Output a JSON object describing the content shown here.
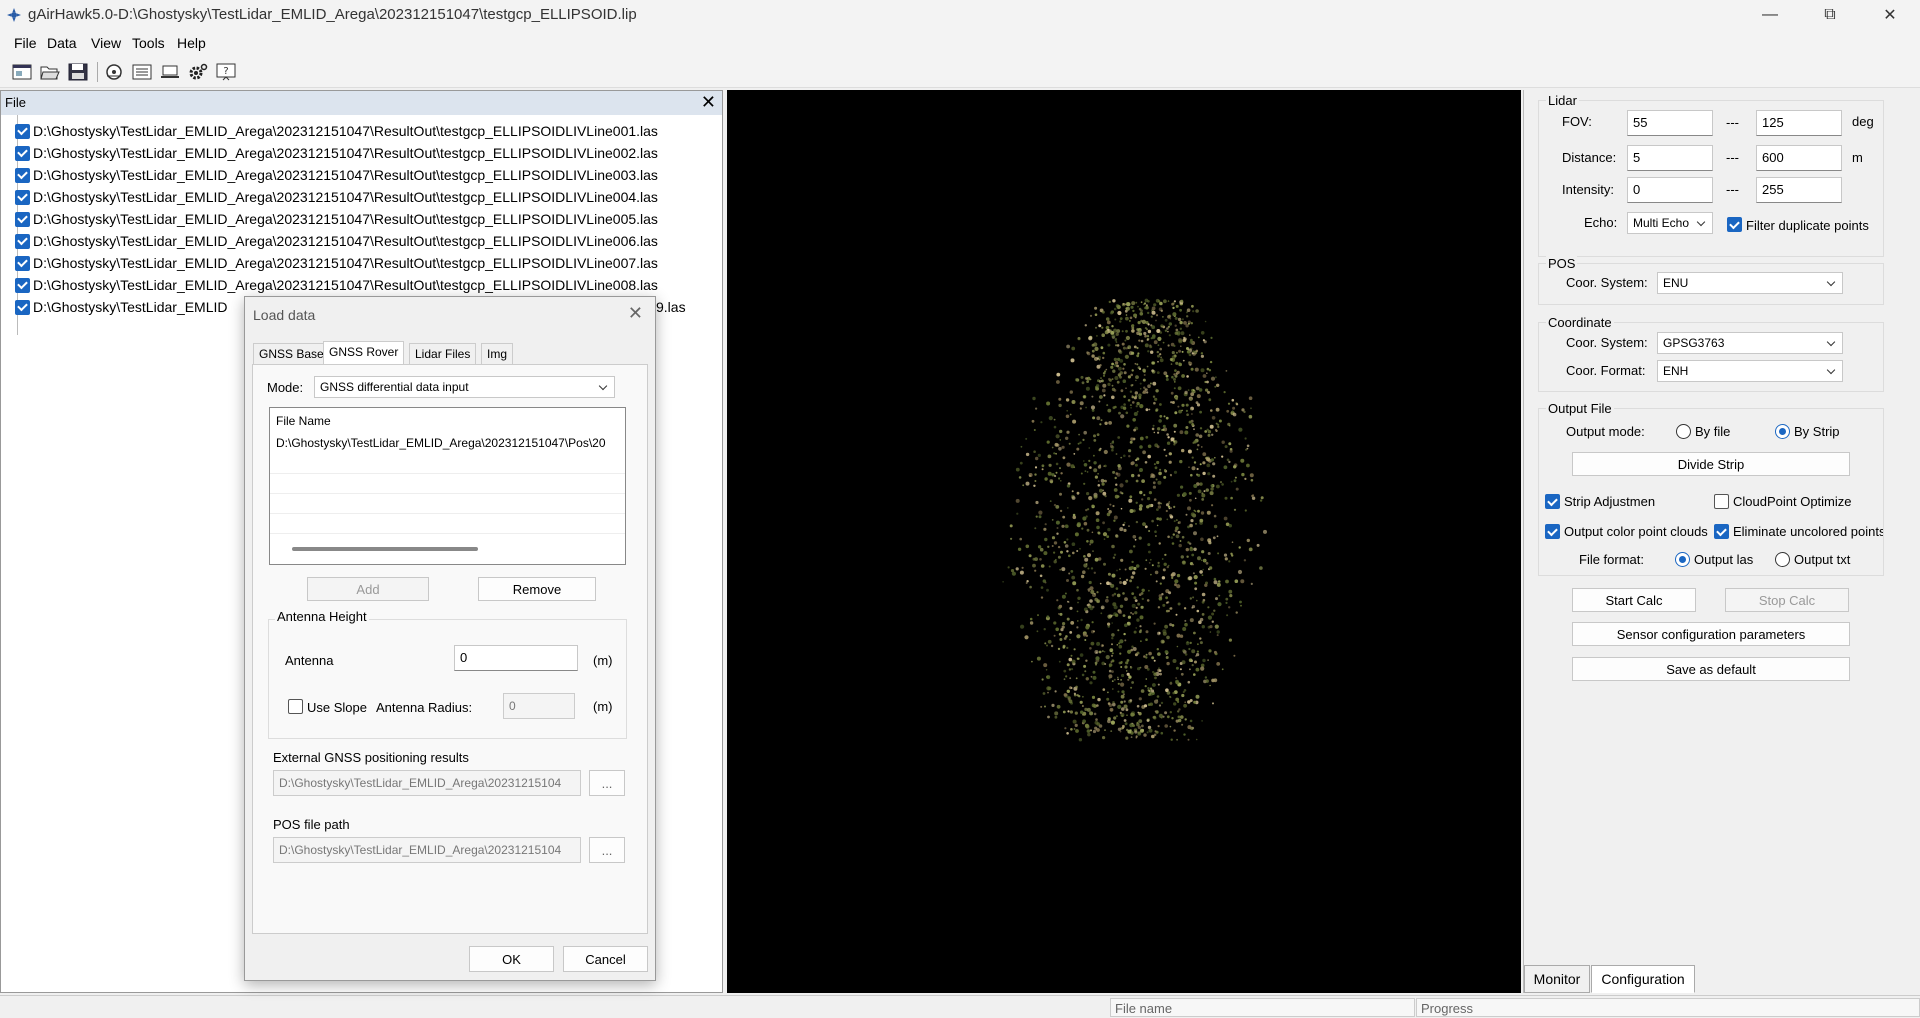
{
  "window": {
    "title": "gAirHawk5.0-D:\\Ghostysky\\TestLidar_EMLID_Arega\\202312151047\\testgcp_ELLIPSOID.lip",
    "controls": [
      "minimize-icon",
      "restore-icon",
      "close-icon"
    ]
  },
  "menu": [
    "File",
    "Data",
    "View",
    "Tools",
    "Help"
  ],
  "toolbar": {
    "icons": [
      "new-project-icon",
      "open-folder-icon",
      "save-icon",
      "load-data-icon",
      "list-icon",
      "laptop-icon",
      "settings-icon",
      "help-icon"
    ]
  },
  "file_panel": {
    "title": "File",
    "files": [
      "D:\\Ghostysky\\TestLidar_EMLID_Arega\\202312151047\\ResultOut\\testgcp_ELLIPSOIDLIVLine001.las",
      "D:\\Ghostysky\\TestLidar_EMLID_Arega\\202312151047\\ResultOut\\testgcp_ELLIPSOIDLIVLine002.las",
      "D:\\Ghostysky\\TestLidar_EMLID_Arega\\202312151047\\ResultOut\\testgcp_ELLIPSOIDLIVLine003.las",
      "D:\\Ghostysky\\TestLidar_EMLID_Arega\\202312151047\\ResultOut\\testgcp_ELLIPSOIDLIVLine004.las",
      "D:\\Ghostysky\\TestLidar_EMLID_Arega\\202312151047\\ResultOut\\testgcp_ELLIPSOIDLIVLine005.las",
      "D:\\Ghostysky\\TestLidar_EMLID_Arega\\202312151047\\ResultOut\\testgcp_ELLIPSOIDLIVLine006.las",
      "D:\\Ghostysky\\TestLidar_EMLID_Arega\\202312151047\\ResultOut\\testgcp_ELLIPSOIDLIVLine007.las",
      "D:\\Ghostysky\\TestLidar_EMLID_Arega\\202312151047\\ResultOut\\testgcp_ELLIPSOIDLIVLine008.las",
      "D:\\Ghostysky\\TestLidar_EMLID",
      "9.las"
    ]
  },
  "config": {
    "lidar": {
      "title": "Lidar",
      "fov_label": "FOV:",
      "fov_min": "55",
      "fov_max": "125",
      "fov_unit": "deg",
      "distance_label": "Distance:",
      "distance_min": "5",
      "distance_max": "600",
      "distance_unit": "m",
      "intensity_label": "Intensity:",
      "intensity_min": "0",
      "intensity_max": "255",
      "range_sep": "---",
      "echo_label": "Echo:",
      "echo_value": "Multi Echo",
      "filter_dup_label": "Filter duplicate points",
      "filter_dup_checked": true
    },
    "pos": {
      "title": "POS",
      "coor_system_label": "Coor. System:",
      "coor_system_value": "ENU"
    },
    "coordinate": {
      "title": "Coordinate",
      "coor_system_label": "Coor. System:",
      "coor_system_value": "GPSG3763",
      "coor_format_label": "Coor. Format:",
      "coor_format_value": "ENH"
    },
    "output": {
      "title": "Output File",
      "mode_label": "Output mode:",
      "by_file": "By file",
      "by_strip": "By Strip",
      "mode_selected": "By Strip",
      "divide_strip": "Divide Strip",
      "strip_adjust": "Strip Adjustmen",
      "strip_adjust_checked": true,
      "cloud_optimize": "CloudPoint Optimize",
      "cloud_optimize_checked": false,
      "color_clouds": "Output color point clouds",
      "color_clouds_checked": true,
      "eliminate_uncolored": "Eliminate uncolored points",
      "eliminate_uncolored_checked": true,
      "format_label": "File format:",
      "format_las": "Output las",
      "format_txt": "Output txt",
      "format_selected": "Output las"
    },
    "start_calc": "Start Calc",
    "stop_calc": "Stop Calc",
    "sensor_params": "Sensor configuration parameters",
    "save_default": "Save as default"
  },
  "bottom_tabs": [
    "Monitor",
    "Configuration"
  ],
  "active_bottom_tab": "Configuration",
  "statusbar": {
    "file_name": "File name",
    "progress": "Progress"
  },
  "dialog": {
    "title": "Load data",
    "tabs": [
      "GNSS Base",
      "GNSS Rover",
      "Lidar Files",
      "Img"
    ],
    "active_tab": "GNSS Rover",
    "mode_label": "Mode:",
    "mode_value": "GNSS differential data input",
    "list_header": "File Name",
    "list_rows": [
      "D:\\Ghostysky\\TestLidar_EMLID_Arega\\202312151047\\Pos\\20"
    ],
    "add": "Add",
    "remove": "Remove",
    "antenna_group": "Antenna Height",
    "antenna_label": "Antenna",
    "antenna_value": "0",
    "unit_m": "(m)",
    "use_slope": "Use Slope",
    "use_slope_checked": false,
    "antenna_radius_label": "Antenna Radius:",
    "antenna_radius_value": "0",
    "ext_gnss_label": "External GNSS positioning results",
    "ext_gnss_value": "D:\\Ghostysky\\TestLidar_EMLID_Arega\\20231215104",
    "pos_path_label": "POS file path",
    "pos_path_value": "D:\\Ghostysky\\TestLidar_EMLID_Arega\\20231215104",
    "browse": "...",
    "ok": "OK",
    "cancel": "Cancel"
  }
}
